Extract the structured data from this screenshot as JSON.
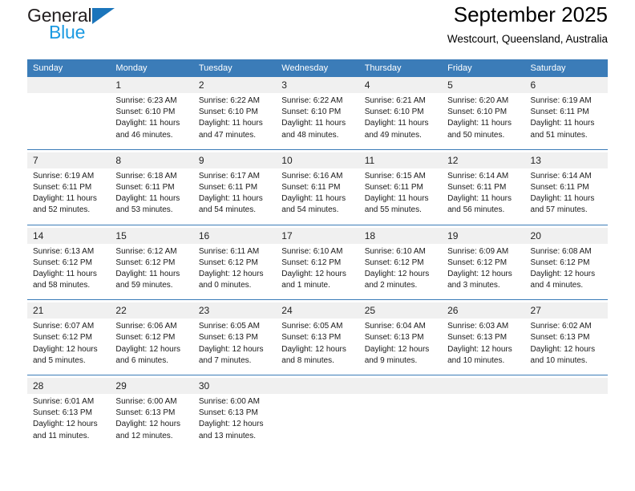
{
  "brand": {
    "name_part1": "General",
    "name_part2": "Blue",
    "logo_icon": "triangle-right-icon",
    "accent_dark_blue": "#1b75bb",
    "accent_light_blue": "#1b9ae2"
  },
  "header": {
    "title": "September 2025",
    "subtitle": "Westcourt, Queensland, Australia"
  },
  "theme": {
    "header_row_bg": "#3b7cb8",
    "daynum_bg": "#f0f0f0",
    "cell_bg": "#ffffff",
    "text": "#000000"
  },
  "weekday_headers": [
    "Sunday",
    "Monday",
    "Tuesday",
    "Wednesday",
    "Thursday",
    "Friday",
    "Saturday"
  ],
  "weeks": [
    {
      "days": [
        {
          "num": "",
          "sunrise": "",
          "sunset": "",
          "daylight1": "",
          "daylight2": "",
          "empty": true
        },
        {
          "num": "1",
          "sunrise": "Sunrise: 6:23 AM",
          "sunset": "Sunset: 6:10 PM",
          "daylight1": "Daylight: 11 hours",
          "daylight2": "and 46 minutes.",
          "empty": false
        },
        {
          "num": "2",
          "sunrise": "Sunrise: 6:22 AM",
          "sunset": "Sunset: 6:10 PM",
          "daylight1": "Daylight: 11 hours",
          "daylight2": "and 47 minutes.",
          "empty": false
        },
        {
          "num": "3",
          "sunrise": "Sunrise: 6:22 AM",
          "sunset": "Sunset: 6:10 PM",
          "daylight1": "Daylight: 11 hours",
          "daylight2": "and 48 minutes.",
          "empty": false
        },
        {
          "num": "4",
          "sunrise": "Sunrise: 6:21 AM",
          "sunset": "Sunset: 6:10 PM",
          "daylight1": "Daylight: 11 hours",
          "daylight2": "and 49 minutes.",
          "empty": false
        },
        {
          "num": "5",
          "sunrise": "Sunrise: 6:20 AM",
          "sunset": "Sunset: 6:10 PM",
          "daylight1": "Daylight: 11 hours",
          "daylight2": "and 50 minutes.",
          "empty": false
        },
        {
          "num": "6",
          "sunrise": "Sunrise: 6:19 AM",
          "sunset": "Sunset: 6:11 PM",
          "daylight1": "Daylight: 11 hours",
          "daylight2": "and 51 minutes.",
          "empty": false
        }
      ]
    },
    {
      "days": [
        {
          "num": "7",
          "sunrise": "Sunrise: 6:19 AM",
          "sunset": "Sunset: 6:11 PM",
          "daylight1": "Daylight: 11 hours",
          "daylight2": "and 52 minutes.",
          "empty": false
        },
        {
          "num": "8",
          "sunrise": "Sunrise: 6:18 AM",
          "sunset": "Sunset: 6:11 PM",
          "daylight1": "Daylight: 11 hours",
          "daylight2": "and 53 minutes.",
          "empty": false
        },
        {
          "num": "9",
          "sunrise": "Sunrise: 6:17 AM",
          "sunset": "Sunset: 6:11 PM",
          "daylight1": "Daylight: 11 hours",
          "daylight2": "and 54 minutes.",
          "empty": false
        },
        {
          "num": "10",
          "sunrise": "Sunrise: 6:16 AM",
          "sunset": "Sunset: 6:11 PM",
          "daylight1": "Daylight: 11 hours",
          "daylight2": "and 54 minutes.",
          "empty": false
        },
        {
          "num": "11",
          "sunrise": "Sunrise: 6:15 AM",
          "sunset": "Sunset: 6:11 PM",
          "daylight1": "Daylight: 11 hours",
          "daylight2": "and 55 minutes.",
          "empty": false
        },
        {
          "num": "12",
          "sunrise": "Sunrise: 6:14 AM",
          "sunset": "Sunset: 6:11 PM",
          "daylight1": "Daylight: 11 hours",
          "daylight2": "and 56 minutes.",
          "empty": false
        },
        {
          "num": "13",
          "sunrise": "Sunrise: 6:14 AM",
          "sunset": "Sunset: 6:11 PM",
          "daylight1": "Daylight: 11 hours",
          "daylight2": "and 57 minutes.",
          "empty": false
        }
      ]
    },
    {
      "days": [
        {
          "num": "14",
          "sunrise": "Sunrise: 6:13 AM",
          "sunset": "Sunset: 6:12 PM",
          "daylight1": "Daylight: 11 hours",
          "daylight2": "and 58 minutes.",
          "empty": false
        },
        {
          "num": "15",
          "sunrise": "Sunrise: 6:12 AM",
          "sunset": "Sunset: 6:12 PM",
          "daylight1": "Daylight: 11 hours",
          "daylight2": "and 59 minutes.",
          "empty": false
        },
        {
          "num": "16",
          "sunrise": "Sunrise: 6:11 AM",
          "sunset": "Sunset: 6:12 PM",
          "daylight1": "Daylight: 12 hours",
          "daylight2": "and 0 minutes.",
          "empty": false
        },
        {
          "num": "17",
          "sunrise": "Sunrise: 6:10 AM",
          "sunset": "Sunset: 6:12 PM",
          "daylight1": "Daylight: 12 hours",
          "daylight2": "and 1 minute.",
          "empty": false
        },
        {
          "num": "18",
          "sunrise": "Sunrise: 6:10 AM",
          "sunset": "Sunset: 6:12 PM",
          "daylight1": "Daylight: 12 hours",
          "daylight2": "and 2 minutes.",
          "empty": false
        },
        {
          "num": "19",
          "sunrise": "Sunrise: 6:09 AM",
          "sunset": "Sunset: 6:12 PM",
          "daylight1": "Daylight: 12 hours",
          "daylight2": "and 3 minutes.",
          "empty": false
        },
        {
          "num": "20",
          "sunrise": "Sunrise: 6:08 AM",
          "sunset": "Sunset: 6:12 PM",
          "daylight1": "Daylight: 12 hours",
          "daylight2": "and 4 minutes.",
          "empty": false
        }
      ]
    },
    {
      "days": [
        {
          "num": "21",
          "sunrise": "Sunrise: 6:07 AM",
          "sunset": "Sunset: 6:12 PM",
          "daylight1": "Daylight: 12 hours",
          "daylight2": "and 5 minutes.",
          "empty": false
        },
        {
          "num": "22",
          "sunrise": "Sunrise: 6:06 AM",
          "sunset": "Sunset: 6:12 PM",
          "daylight1": "Daylight: 12 hours",
          "daylight2": "and 6 minutes.",
          "empty": false
        },
        {
          "num": "23",
          "sunrise": "Sunrise: 6:05 AM",
          "sunset": "Sunset: 6:13 PM",
          "daylight1": "Daylight: 12 hours",
          "daylight2": "and 7 minutes.",
          "empty": false
        },
        {
          "num": "24",
          "sunrise": "Sunrise: 6:05 AM",
          "sunset": "Sunset: 6:13 PM",
          "daylight1": "Daylight: 12 hours",
          "daylight2": "and 8 minutes.",
          "empty": false
        },
        {
          "num": "25",
          "sunrise": "Sunrise: 6:04 AM",
          "sunset": "Sunset: 6:13 PM",
          "daylight1": "Daylight: 12 hours",
          "daylight2": "and 9 minutes.",
          "empty": false
        },
        {
          "num": "26",
          "sunrise": "Sunrise: 6:03 AM",
          "sunset": "Sunset: 6:13 PM",
          "daylight1": "Daylight: 12 hours",
          "daylight2": "and 10 minutes.",
          "empty": false
        },
        {
          "num": "27",
          "sunrise": "Sunrise: 6:02 AM",
          "sunset": "Sunset: 6:13 PM",
          "daylight1": "Daylight: 12 hours",
          "daylight2": "and 10 minutes.",
          "empty": false
        }
      ]
    },
    {
      "days": [
        {
          "num": "28",
          "sunrise": "Sunrise: 6:01 AM",
          "sunset": "Sunset: 6:13 PM",
          "daylight1": "Daylight: 12 hours",
          "daylight2": "and 11 minutes.",
          "empty": false
        },
        {
          "num": "29",
          "sunrise": "Sunrise: 6:00 AM",
          "sunset": "Sunset: 6:13 PM",
          "daylight1": "Daylight: 12 hours",
          "daylight2": "and 12 minutes.",
          "empty": false
        },
        {
          "num": "30",
          "sunrise": "Sunrise: 6:00 AM",
          "sunset": "Sunset: 6:13 PM",
          "daylight1": "Daylight: 12 hours",
          "daylight2": "and 13 minutes.",
          "empty": false
        },
        {
          "num": "",
          "sunrise": "",
          "sunset": "",
          "daylight1": "",
          "daylight2": "",
          "empty": true
        },
        {
          "num": "",
          "sunrise": "",
          "sunset": "",
          "daylight1": "",
          "daylight2": "",
          "empty": true
        },
        {
          "num": "",
          "sunrise": "",
          "sunset": "",
          "daylight1": "",
          "daylight2": "",
          "empty": true
        },
        {
          "num": "",
          "sunrise": "",
          "sunset": "",
          "daylight1": "",
          "daylight2": "",
          "empty": true
        }
      ]
    }
  ]
}
